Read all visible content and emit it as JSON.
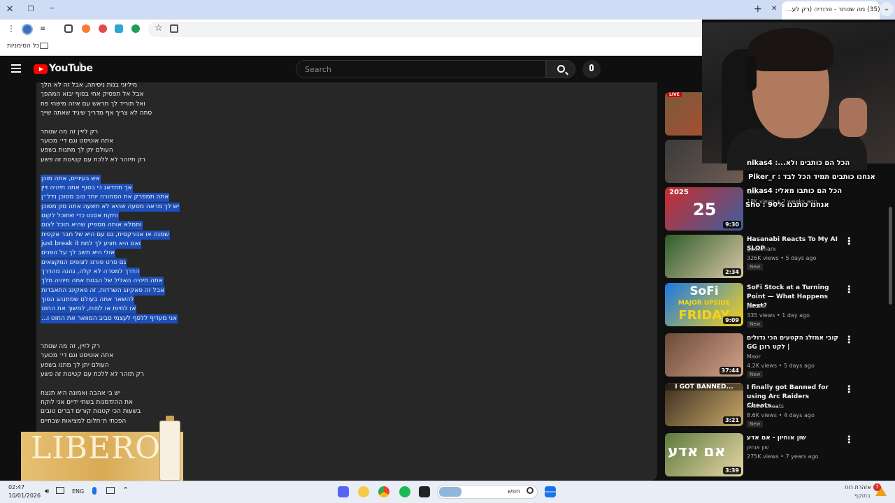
{
  "browser": {
    "tab_title": "(35) מה שנותר - פרודיה (רק לע...",
    "bookmarks_label": "כל הסימניות",
    "colors": {
      "tabbar": "#cfdcf5",
      "youtube_red": "#ff0000"
    }
  },
  "youtube": {
    "logo_text": "YouTube",
    "region": "IL",
    "search_placeholder": "Search"
  },
  "lyrics": [
    {
      "text": "מיליוני בנות ניסיתה, אבל זה לא הלך",
      "selected": false
    },
    {
      "text": "אבל אל תפסיק אחי בסוף יבוא המהפך",
      "selected": false
    },
    {
      "text": "ואל תוריד לך תראש עם איזה מישהי פח",
      "selected": false
    },
    {
      "text": "סתה לא צריך אף מדריך שיגיד שאתה שייך",
      "selected": false
    },
    {
      "text": "",
      "selected": false
    },
    {
      "text": "רק לזיין זה מה שנותר",
      "selected": false
    },
    {
      "text": "אתה אוטיסט וגם די׳ מכוער",
      "selected": false
    },
    {
      "text": "העולם יתן לך מתנות בשפע",
      "selected": false
    },
    {
      "text": "רק תיזהר לא ללכת עם קטינות זה פשע",
      "selected": false
    },
    {
      "text": "",
      "selected": false
    },
    {
      "text": "אש בעיניים, אתה מוכן",
      "selected": true
    },
    {
      "text": "אך תתדאג כי בסוף אתה תיהיה זיין",
      "selected": true
    },
    {
      "text": "אתה תמפרק את הסחורה יותר טוב מסוכן נדל״ן",
      "selected": true
    },
    {
      "text": "יש לך מראה מסעה שהיא לא תשעה אתה מזן מסוכן",
      "selected": true
    },
    {
      "text": "ותקח אסנט כדי שתוכל לקום",
      "selected": true
    },
    {
      "text": "ותמלא אותה מספיק שהיא תוכל לצום",
      "selected": true
    },
    {
      "text": "שמנה או אנורקסית, גם עם היא של חבר אקסית",
      "selected": true
    },
    {
      "text": "just break it ואם היא תציע לך לתת",
      "selected": true
    },
    {
      "text": "אולי היא תשב לך על הפנים",
      "selected": true
    },
    {
      "text": "גם סרט פורנו לצופים המקצאים",
      "selected": true
    },
    {
      "text": "הדרך למסרה לא קלה, נהנה מהדרך",
      "selected": true
    },
    {
      "text": "אתה תיהיה האליל של הבנות אתה תיהיה מלך",
      "selected": true
    },
    {
      "text": "אבל זה פאקינג השרדות, זה פאקינג התאבדות",
      "selected": true
    },
    {
      "text": "להשאר אתה בעולם שמתנהג הפוך",
      "selected": true
    },
    {
      "text": "אז לחיות או למות, למשוך את החוט",
      "selected": true
    },
    {
      "text": "אני מעדיף ללפף לעצמי סביב המוואר את החוט ו...",
      "selected": true
    },
    {
      "text": "",
      "selected": false
    },
    {
      "text": "",
      "selected": false
    },
    {
      "text": "רק לזיין, זה מה שנותר",
      "selected": false
    },
    {
      "text": "אתה אוטיסט וגם די׳ מכוער",
      "selected": false
    },
    {
      "text": "העולם יתן לך מתנו בשפע",
      "selected": false
    },
    {
      "text": "רק תזהר לא ללכת עם קטינות זה פשע",
      "selected": false
    },
    {
      "text": "",
      "selected": false
    },
    {
      "text": "יש בי אהבה ואמונה היא תנצח",
      "selected": false
    },
    {
      "text": "את ההזדמנות בשתי ידיים אני לוקח",
      "selected": false
    },
    {
      "text": "בשעות הכי קטנות קורים דברים טובים",
      "selected": false
    },
    {
      "text": "הפכתי ת׳חלום למציאות שבחיים",
      "selected": false
    }
  ],
  "ad": {
    "brand": "LIBERO"
  },
  "sidebar": [
    {
      "title": "",
      "channel": "",
      "meta": "",
      "badge": "",
      "duration": "",
      "thumb_colors": [
        "#7a5a3d",
        "#b84a2a"
      ],
      "live": "LIVE"
    },
    {
      "title": "",
      "channel": "",
      "meta": "",
      "badge": "",
      "duration": "",
      "thumb_colors": [
        "#3a3a3a",
        "#6e5c54"
      ],
      "live": ""
    },
    {
      "title": "",
      "channel": "Sho...",
      "meta": "18K views • 2 weeks ago",
      "badge": "",
      "duration": "9:30",
      "thumb_colors": [
        "#cc2c2c",
        "#3a5fa0"
      ],
      "live": ""
    },
    {
      "title": "Hasanabi Reacts To My AI SLOP",
      "channel": "guccimarx",
      "meta": "326K views • 5 days ago",
      "badge": "New",
      "duration": "2:34",
      "thumb_colors": [
        "#2f5d2a",
        "#d9c7a6"
      ],
      "live": ""
    },
    {
      "title": "SoFi Stock at a Turning Point — What Happens Next?",
      "channel": "Jxt SM",
      "meta": "335 views • 1 day ago",
      "badge": "New",
      "duration": "9:09",
      "thumb_colors": [
        "#1877e6",
        "#f7d21a"
      ],
      "live": ""
    },
    {
      "title": "קובי אמזלג הקטעים הכי גדולים | לקט רונן GG",
      "channel": "Maor",
      "meta": "4.2K views • 5 days ago",
      "badge": "New",
      "duration": "37:44",
      "thumb_colors": [
        "#6b4a3a",
        "#d4a38a"
      ],
      "live": ""
    },
    {
      "title": "I finally got Banned for using Arc Raiders Cheats...",
      "channel": "Arctic Cheats",
      "meta": "8.6K views • 4 days ago",
      "badge": "New",
      "duration": "3:21",
      "thumb_colors": [
        "#3a2e20",
        "#c9a86a"
      ],
      "live": ""
    },
    {
      "title": "שון אוחיון - אם אדע",
      "channel": "שון אוחיון",
      "meta": "275K views • 7 years ago",
      "badge": "",
      "duration": "3:39",
      "thumb_colors": [
        "#5e7a3a",
        "#e8d7a8"
      ],
      "live": ""
    }
  ],
  "thumb_text": {
    "sofi": "SoFi",
    "sofi_sub": "MAJOR UPSIDE",
    "sofi_sub2": "FRIDAY",
    "banned": "I GOT BANNED...",
    "year": "2025",
    "hebrew_song": "אם אדע"
  },
  "chat": [
    {
      "text": "הכל הם כותבים ולא...: nikas4"
    },
    {
      "text": "אנחנו כותבים תמיד הכל לבד : Piker_r"
    },
    {
      "text": "הכל הם כותבו מאלי: nikas4"
    },
    {
      "text": "אנחנו כותבנו 90% : Sho"
    }
  ],
  "taskbar": {
    "time": "02:47",
    "date": "10/01/2026",
    "lang": "ENG",
    "search_label": "חפש",
    "weather_title": "אזהרת רוח",
    "weather_sub": "בתוקף",
    "notif_count": "7"
  }
}
